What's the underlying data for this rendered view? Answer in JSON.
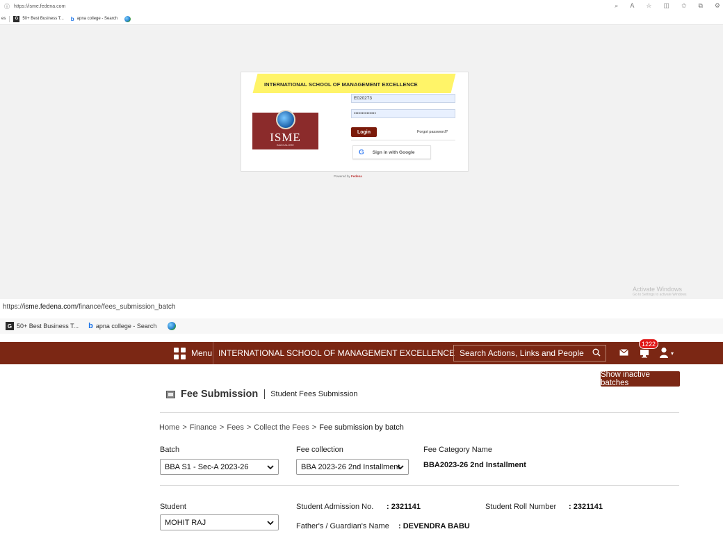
{
  "login_screen": {
    "browser": {
      "url": "https://isme.fedena.com",
      "bookmarks": [
        {
          "label": "es"
        },
        {
          "label": "50+ Best Business T..."
        },
        {
          "label": "apna college - Search"
        }
      ]
    },
    "school_name": "INTERNATIONAL SCHOOL OF MANAGEMENT EXCELLENCE",
    "logo_text": "ISME",
    "logo_subtext": "BANGALORE",
    "username_value": "E020273",
    "password_value": "••••••••••••••",
    "login_label": "Login",
    "forgot_label": "Forgot password?",
    "google_label": "Sign in with Google",
    "powered_by_prefix": "Powered by",
    "powered_by_brand": "Fedena",
    "activate_title": "Activate Windows",
    "activate_subtitle": "Go to Settings to activate Windows"
  },
  "fee_screen": {
    "browser": {
      "url_prefix": "https://",
      "url_domain": "isme.fedena.com",
      "url_path": "/finance/fees_submission_batch",
      "bookmarks": [
        {
          "label": "50+ Best Business T..."
        },
        {
          "label": "apna college - Search"
        }
      ]
    },
    "nav": {
      "menu_label": "Menu",
      "title": "INTERNATIONAL SCHOOL OF MANAGEMENT EXCELLENCE",
      "search_placeholder": "Search Actions, Links and People",
      "notification_count": "1222"
    },
    "inactive_batches_label": "Show inactive batches",
    "page_title": "Fee Submission",
    "page_subtitle": "Student Fees Submission",
    "breadcrumb": {
      "home": "Home",
      "finance": "Finance",
      "fees": "Fees",
      "collect": "Collect the Fees",
      "current": "Fee submission by batch",
      "separator": ">"
    },
    "batch_label": "Batch",
    "batch_selected": "BBA S1 - Sec-A 2023-26",
    "fee_collection_label": "Fee collection",
    "fee_collection_selected": "BBA 2023-26 2nd Installment",
    "fee_category_label": "Fee Category Name",
    "fee_category_value": "BBA2023-26 2nd Installment",
    "student_label": "Student",
    "student_selected": "MOHIT RAJ",
    "admission_label": "Student Admission No.",
    "admission_value": ": 2321141",
    "roll_label": "Student Roll Number",
    "roll_value": ": 2321141",
    "guardian_label": "Father's / Guardian's Name",
    "guardian_value": ": DEVENDRA BABU"
  },
  "colors": {
    "brand": "#7b2714",
    "login_button": "#7b1a0a",
    "badge": "#e01515",
    "highlight": "#fff028"
  }
}
